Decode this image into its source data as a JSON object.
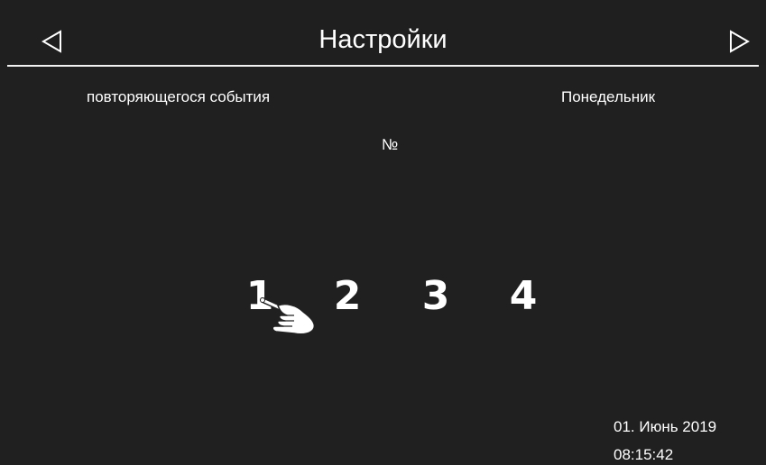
{
  "header": {
    "title": "Настройки",
    "prev_icon": "triangle-left-icon",
    "next_icon": "triangle-right-icon"
  },
  "content": {
    "event_label": "повторяющегося события",
    "day_label": "Понедельник",
    "number_label": "№",
    "numbers": [
      "1",
      "2",
      "3",
      "4"
    ],
    "pointer_icon": "hand-pointer-icon"
  },
  "status": {
    "date": "01. Июнь 2019",
    "time": "08:15:42"
  },
  "colors": {
    "background": "#202020",
    "foreground": "#ffffff",
    "rule": "#f2f2f2"
  }
}
